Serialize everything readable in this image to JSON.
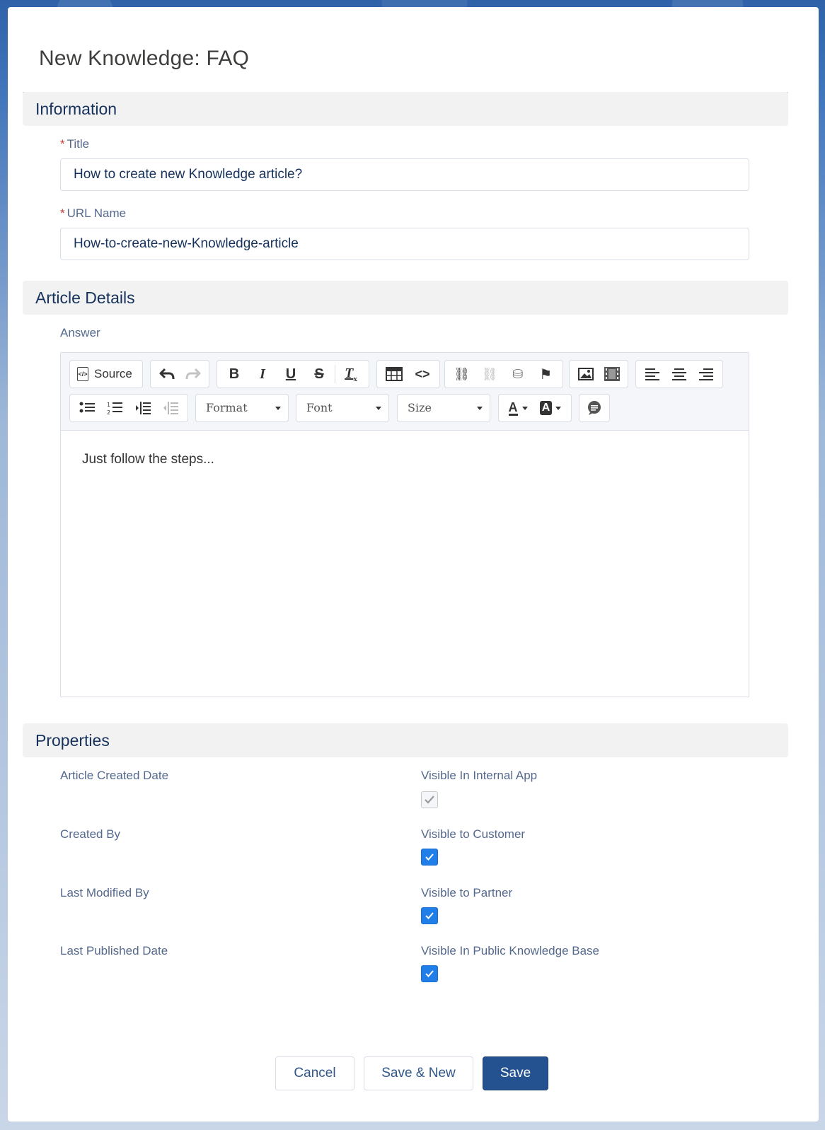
{
  "modal": {
    "title": "New Knowledge: FAQ"
  },
  "sections": {
    "information": "Information",
    "article_details": "Article Details",
    "properties": "Properties"
  },
  "fields": {
    "title": {
      "label": "Title",
      "required": "*",
      "value": "How to create new Knowledge article?"
    },
    "url_name": {
      "label": "URL Name",
      "required": "*",
      "value": "How-to-create-new-Knowledge-article"
    },
    "answer": {
      "label": "Answer",
      "value": "Just follow the steps..."
    }
  },
  "editor_toolbar": {
    "source_label": "Source",
    "format_label": "Format",
    "font_label": "Font",
    "size_label": "Size",
    "icons": [
      "source-icon",
      "undo-icon",
      "redo-icon",
      "bold-icon",
      "italic-icon",
      "underline-icon",
      "strikethrough-icon",
      "remove-format-icon",
      "table-icon",
      "code-icon",
      "link-icon",
      "unlink-icon",
      "anchor-icon",
      "flag-icon",
      "image-icon",
      "video-icon",
      "align-left-icon",
      "align-center-icon",
      "align-right-icon",
      "bulleted-list-icon",
      "numbered-list-icon",
      "indent-icon",
      "outdent-icon",
      "text-color-icon",
      "background-color-icon",
      "comment-icon"
    ]
  },
  "properties": {
    "left": [
      "Article Created Date",
      "Created By",
      "Last Modified By",
      "Last Published Date"
    ],
    "right": [
      {
        "label": "Visible In Internal App",
        "checked": true,
        "disabled": true
      },
      {
        "label": "Visible to Customer",
        "checked": true,
        "disabled": false
      },
      {
        "label": "Visible to Partner",
        "checked": true,
        "disabled": false
      },
      {
        "label": "Visible In Public Knowledge Base",
        "checked": true,
        "disabled": false
      }
    ]
  },
  "footer": {
    "cancel_label": "Cancel",
    "save_new_label": "Save & New",
    "save_label": "Save"
  },
  "colors": {
    "brand_button": "#24518f",
    "checkbox_checked": "#1f7ee8",
    "required_asterisk": "#c23934",
    "section_header_bg": "#f3f2f2"
  }
}
